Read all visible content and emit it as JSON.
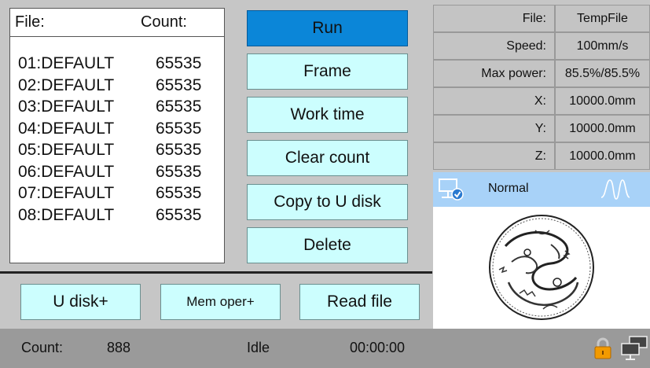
{
  "file_panel": {
    "file_label": "File:",
    "count_label": "Count:",
    "files": [
      {
        "name": "01:DEFAULT",
        "count": "65535"
      },
      {
        "name": "02:DEFAULT",
        "count": "65535"
      },
      {
        "name": "03:DEFAULT",
        "count": "65535"
      },
      {
        "name": "04:DEFAULT",
        "count": "65535"
      },
      {
        "name": "05:DEFAULT",
        "count": "65535"
      },
      {
        "name": "06:DEFAULT",
        "count": "65535"
      },
      {
        "name": "07:DEFAULT",
        "count": "65535"
      },
      {
        "name": "08:DEFAULT",
        "count": "65535"
      }
    ]
  },
  "actions": {
    "run": "Run",
    "frame": "Frame",
    "work_time": "Work time",
    "clear_count": "Clear count",
    "copy_to_u_disk": "Copy to U disk",
    "delete": "Delete"
  },
  "bottom_buttons": {
    "u_disk": "U disk+",
    "mem_oper": "Mem oper+",
    "read_file": "Read file"
  },
  "info": {
    "file_label": "File:",
    "file_value": "TempFile",
    "speed_label": "Speed:",
    "speed_value": "100mm/s",
    "max_power_label": "Max power:",
    "max_power_value": "85.5%/85.5%",
    "x_label": "X:",
    "x_value": "10000.0mm",
    "y_label": "Y:",
    "y_value": "10000.0mm",
    "z_label": "Z:",
    "z_value": "10000.0mm"
  },
  "status": {
    "mode": "Normal"
  },
  "status_bar": {
    "count_label": "Count:",
    "count_value": "888",
    "state": "Idle",
    "time": "00:00:00"
  },
  "colors": {
    "run_button": "#0b86d8",
    "button_bg": "#ccfefe",
    "status_strip": "#a8d2f8",
    "lock_icon": "#f29a00"
  },
  "icons": [
    "monitor-check-icon",
    "waveform-icon",
    "lock-icon",
    "network-icon"
  ]
}
